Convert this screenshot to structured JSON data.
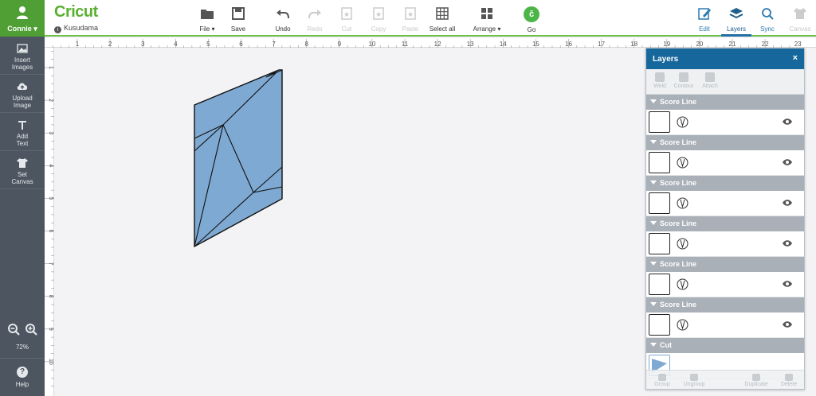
{
  "user": {
    "name": "Connie"
  },
  "brand": {
    "logo": "Cricut",
    "project": "Kusudama"
  },
  "toolbar": {
    "file": "File",
    "save": "Save",
    "undo": "Undo",
    "redo": "Redo",
    "cut": "Cut",
    "copy": "Copy",
    "paste": "Paste",
    "select_all": "Select all",
    "arrange": "Arrange",
    "go": "Go",
    "go_glyph": "č"
  },
  "right_tabs": {
    "edit": "Edit",
    "layers": "Layers",
    "sync": "Sync",
    "canvas": "Canvas"
  },
  "sidebar": {
    "insert_images": [
      "Insert",
      "Images"
    ],
    "upload_image": [
      "Upload",
      "Image"
    ],
    "add_text": [
      "Add",
      "Text"
    ],
    "set_canvas": [
      "Set",
      "Canvas"
    ],
    "zoom": "72%",
    "help": "Help"
  },
  "ruler": {
    "h": [
      "1",
      "2",
      "3",
      "4",
      "5",
      "6",
      "7",
      "8",
      "9",
      "10",
      "11",
      "12",
      "13",
      "14",
      "15",
      "16",
      "17",
      "18",
      "19",
      "20",
      "21",
      "22",
      "23"
    ],
    "v": [
      "1",
      "2",
      "3",
      "4",
      "5",
      "6",
      "7",
      "8",
      "9",
      "10"
    ]
  },
  "layers": {
    "title": "Layers",
    "close": "×",
    "tools": [
      "Weld",
      "Contour",
      "Attach"
    ],
    "groups": [
      {
        "label": "Score Line"
      },
      {
        "label": "Score Line"
      },
      {
        "label": "Score Line"
      },
      {
        "label": "Score Line"
      },
      {
        "label": "Score Line"
      },
      {
        "label": "Score Line"
      },
      {
        "label": "Cut"
      }
    ],
    "footer": [
      "Group",
      "Ungroup",
      "Duplicate",
      "Delete"
    ]
  },
  "colors": {
    "brand_green": "#5ab031",
    "shape_fill": "#7ea9d2",
    "panel_header": "#16679b",
    "sidebar": "#4c5560"
  }
}
